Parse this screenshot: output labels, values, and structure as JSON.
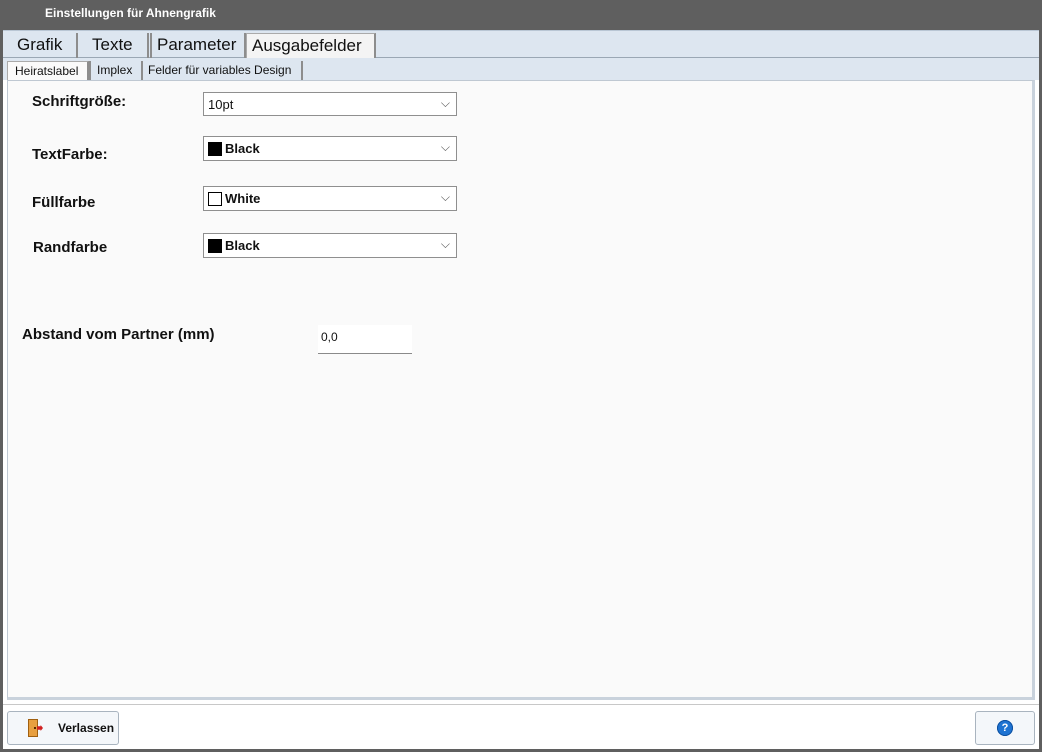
{
  "window": {
    "title": "Einstellungen für Ahnengrafik"
  },
  "main_tabs": [
    {
      "label": "Grafik"
    },
    {
      "label": "Texte"
    },
    {
      "label": "Parameter"
    },
    {
      "label": "Ausgabefelder"
    }
  ],
  "sub_tabs": [
    {
      "label": "Heiratslabel"
    },
    {
      "label": "Implex"
    },
    {
      "label": "Felder für variables Design"
    }
  ],
  "form": {
    "font_size": {
      "label": "Schriftgröße:",
      "value": "10pt"
    },
    "text_color": {
      "label": "TextFarbe:",
      "value": "Black",
      "swatch": "#000000"
    },
    "fill_color": {
      "label": "Füllfarbe",
      "value": "White",
      "swatch": "#ffffff"
    },
    "border_color": {
      "label": "Randfarbe",
      "value": "Black",
      "swatch": "#000000"
    },
    "partner_distance": {
      "label": "Abstand vom Partner (mm)",
      "value": "0,0"
    }
  },
  "footer": {
    "exit_label": "Verlassen",
    "exit_icon": "exit-door-icon",
    "help_icon": "help-icon",
    "help_glyph": "?"
  }
}
